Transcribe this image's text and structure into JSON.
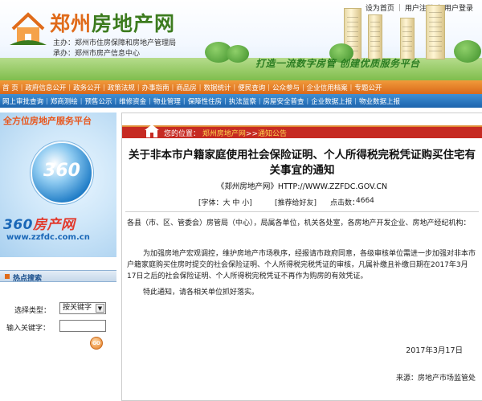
{
  "header": {
    "site_name_part1": "郑州",
    "site_name_part2": "房地产网",
    "sponsor": "主办：郑州市住房保障和房地产管理局",
    "organizer": "承办：郑州市房产信息中心",
    "slogan": "打造一流数字房管 创建优质服务平台",
    "top_links": [
      "设为首页",
      "用户注册",
      "用户登录"
    ]
  },
  "nav_primary": [
    "首 页",
    "政府信息公开",
    "政务公开",
    "政策法规",
    "办事指南",
    "商品房",
    "数据统计",
    "便民查询",
    "公众参与",
    "企业信用档案",
    "专题公开"
  ],
  "nav_secondary": [
    "网上审批查询",
    "郑商测绘",
    "预售公示",
    "维修资金",
    "物业管理",
    "保障性住房",
    "执法监察",
    "房屋安全普查",
    "企业数据上报",
    "物业数据上报"
  ],
  "sidebar": {
    "promo_arc": "全方位房地产服务平台",
    "promo_globe": "360",
    "promo_brand_a": "360",
    "promo_brand_b": "房产网",
    "promo_url": "www.zzfdc.com.cn",
    "hot_search_title": "热点搜索",
    "select_type_label": "选择类型：",
    "select_type_value": "按关键字",
    "keyword_label": "输入关键字：",
    "go_label": "GO"
  },
  "article": {
    "breadcrumb_prefix": "您的位置：",
    "breadcrumb_link": "郑州房地产网",
    "breadcrumb_sep": ">>",
    "breadcrumb_current": "通知公告",
    "title": "关于非本市户籍家庭使用社会保险证明、个人所得税完税凭证购买住宅有关事宜的通知",
    "source_line": "《郑州房地产网》HTTP://WWW.ZZFDC.GOV.CN",
    "font_label": "[字体：大 中 小]",
    "recommend_label": "[推荐给好友]",
    "click_label": "点击数：",
    "click_count": "4664",
    "para1": "各县（市、区、管委会）房管局（中心），局属各单位，机关各处室，各房地产开发企业、房地产经纪机构：",
    "para2": "为加强房地产宏观调控，维护房地产市场秩序，经报请市政府同意，各级审核单位需进一步加强对非本市户籍家庭购买住房时提交的社会保险证明、个人所得税完税凭证的审核，凡属补缴且补缴日期在2017年3月17日之后的社会保险证明、个人所得税完税凭证不再作为购房的有效凭证。",
    "para3": "特此通知，请各相关单位抓好落实。",
    "date": "2017年3月17日",
    "footer_source": "来源：房地产市场监管处"
  }
}
